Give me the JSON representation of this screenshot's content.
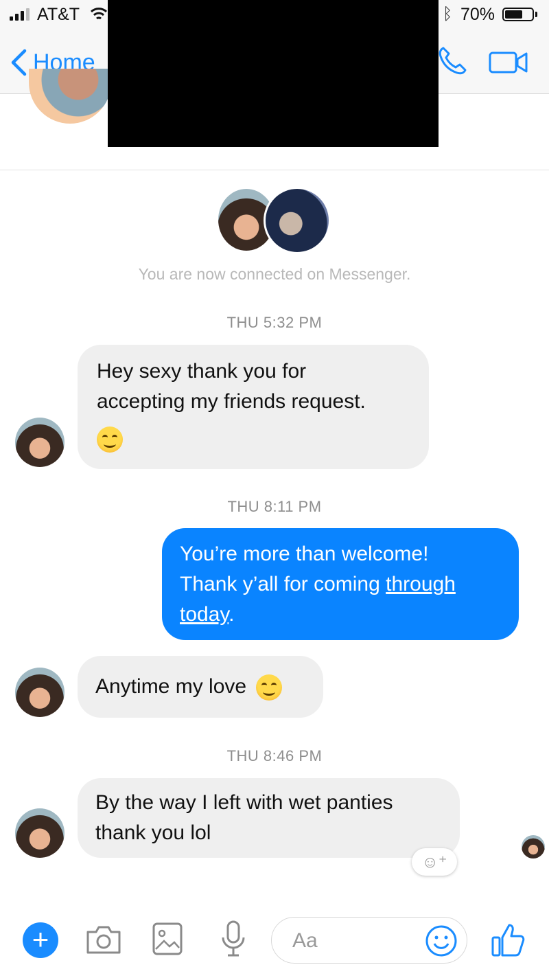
{
  "status_bar": {
    "carrier": "AT&T",
    "battery_text": "70%",
    "battery_level": 0.7
  },
  "nav": {
    "back_label": "Home"
  },
  "conversation": {
    "connected_text": "You are now connected on Messenger.",
    "timestamps": [
      "THU 5:32 PM",
      "THU 8:11 PM",
      "THU 8:46 PM"
    ],
    "messages": [
      {
        "sender": "them",
        "lines": [
          "Hey sexy thank you for",
          "accepting my friends request."
        ],
        "emoji": "smiling-face"
      },
      {
        "sender": "me",
        "line1": "You’re more than welcome!",
        "line2_prefix": "Thank y’all for coming ",
        "line2_link": "through",
        "line3_link": "today",
        "line3_suffix": "."
      },
      {
        "sender": "them",
        "text": "Anytime my love",
        "emoji": "winking-face"
      },
      {
        "sender": "them",
        "lines": [
          "By the way I left with wet panties",
          "thank you  lol"
        ]
      }
    ]
  },
  "composer": {
    "placeholder": "Aa"
  },
  "icons": [
    "signal-icon",
    "wifi-icon",
    "bluetooth-icon",
    "battery-icon",
    "back-chevron-icon",
    "phone-icon",
    "video-icon",
    "add-icon",
    "camera-icon",
    "image-icon",
    "microphone-icon",
    "emoji-icon",
    "thumbs-up-icon",
    "react-emoji-icon"
  ],
  "colors": {
    "accent": "#1a8cff",
    "outgoing_bubble": "#0a84ff",
    "incoming_bubble": "#efefef"
  }
}
